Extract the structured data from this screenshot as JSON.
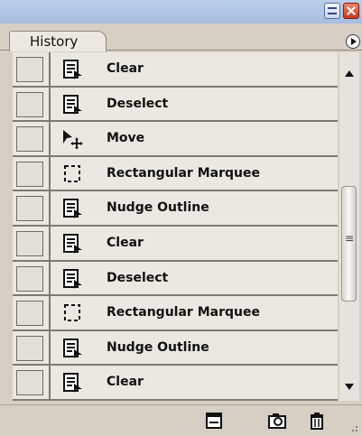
{
  "window": {
    "minimize_icon": "minimize-icon",
    "close_icon": "close-icon"
  },
  "tabs": [
    {
      "label": "History"
    }
  ],
  "panel_menu_icon": "panel-menu-icon",
  "history": {
    "items": [
      {
        "label": "Clear",
        "icon": "document-arrow-icon"
      },
      {
        "label": "Deselect",
        "icon": "document-arrow-icon"
      },
      {
        "label": "Move",
        "icon": "move-tool-icon"
      },
      {
        "label": "Rectangular Marquee",
        "icon": "marquee-icon"
      },
      {
        "label": "Nudge Outline",
        "icon": "document-arrow-icon"
      },
      {
        "label": "Clear",
        "icon": "document-arrow-icon"
      },
      {
        "label": "Deselect",
        "icon": "document-arrow-icon"
      },
      {
        "label": "Rectangular Marquee",
        "icon": "marquee-icon"
      },
      {
        "label": "Nudge Outline",
        "icon": "document-arrow-icon"
      },
      {
        "label": "Clear",
        "icon": "document-arrow-icon"
      }
    ]
  },
  "bottom_toolbar": [
    {
      "icon": "new-document-from-state-icon"
    },
    {
      "icon": "snapshot-camera-icon"
    },
    {
      "icon": "trash-icon"
    }
  ]
}
